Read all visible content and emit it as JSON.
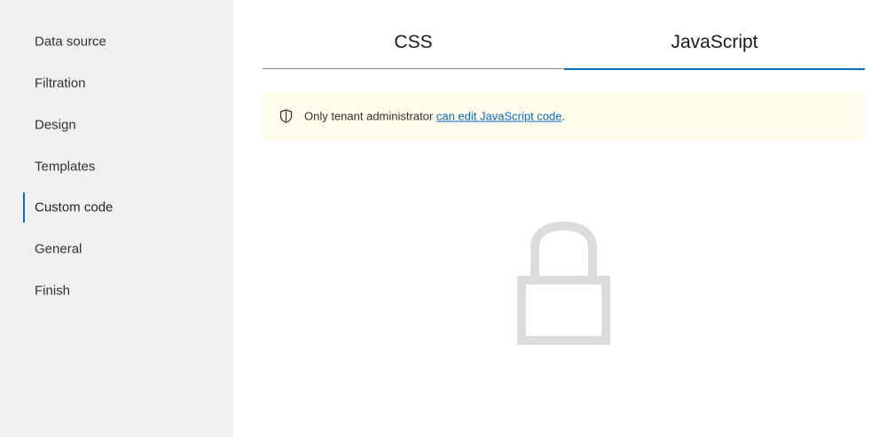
{
  "sidebar": {
    "items": [
      {
        "label": "Data source"
      },
      {
        "label": "Filtration"
      },
      {
        "label": "Design"
      },
      {
        "label": "Templates"
      },
      {
        "label": "Custom code",
        "active": true
      },
      {
        "label": "General"
      },
      {
        "label": "Finish"
      }
    ]
  },
  "tabs": {
    "css_label": "CSS",
    "js_label": "JavaScript",
    "selected": "JavaScript"
  },
  "notice": {
    "text": "Only tenant administrator ",
    "link_text": "can edit JavaScript code",
    "suffix": ".",
    "icon": "shield-icon"
  },
  "lock": {
    "icon": "lock-icon"
  },
  "colors": {
    "sidebar_bg": "#f0f0f0",
    "accent": "#0f6cbd",
    "notice_bg": "#fefcea",
    "lock_gray": "#dcdcdc"
  }
}
